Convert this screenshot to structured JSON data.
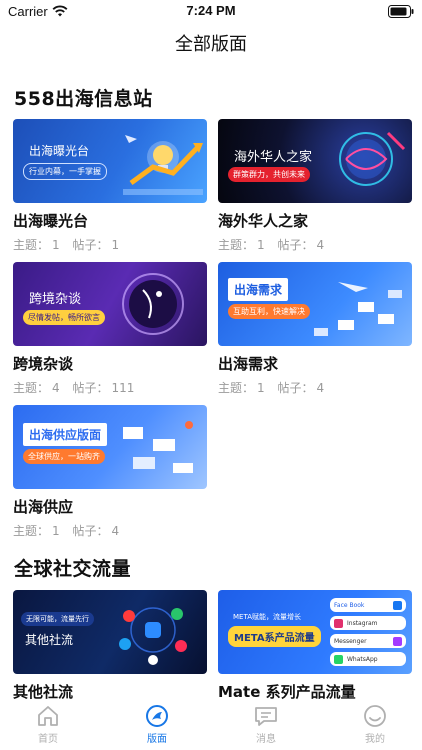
{
  "status": {
    "carrier": "Carrier",
    "time": "7:24 PM"
  },
  "nav": {
    "title": "全部版面"
  },
  "sections": [
    {
      "title": "558出海信息站",
      "cards": [
        {
          "name": "出海曝光台",
          "banner_text": "出海曝光台",
          "banner_sub": "行业内幕，一手掌握",
          "topics_label": "主题：",
          "topics": "1",
          "posts_label": "帖子：",
          "posts": "1"
        },
        {
          "name": "海外华人之家",
          "banner_text": "海外华人之家",
          "banner_sub": "群策群力，共创未来",
          "topics_label": "主题：",
          "topics": "1",
          "posts_label": "帖子：",
          "posts": "4"
        },
        {
          "name": "跨境杂谈",
          "banner_text": "跨境杂谈",
          "banner_sub": "尽情发帖，畅所欲言",
          "topics_label": "主题：",
          "topics": "4",
          "posts_label": "帖子：",
          "posts": "111"
        },
        {
          "name": "出海需求",
          "banner_text": "出海需求",
          "banner_sub": "互助互利，快速解决",
          "topics_label": "主题：",
          "topics": "1",
          "posts_label": "帖子：",
          "posts": "4"
        },
        {
          "name": "出海供应",
          "banner_text": "出海供应版面",
          "banner_sub": "全球供应，一站购齐",
          "topics_label": "主题：",
          "topics": "1",
          "posts_label": "帖子：",
          "posts": "4"
        }
      ]
    },
    {
      "title": "全球社交流量",
      "cards": [
        {
          "name": "其他社流",
          "banner_text": "其他社流",
          "banner_sub": "无限可能，流量先行"
        },
        {
          "name": "Mate 系列产品流量",
          "banner_text": "META系产品流量",
          "banner_sub": "META赋能，流量增长",
          "apps": [
            "Face Book",
            "Instagram",
            "Messenger",
            "WhatsApp"
          ]
        }
      ]
    }
  ],
  "tabs": [
    {
      "label": "首页",
      "icon": "home-icon",
      "active": false
    },
    {
      "label": "版面",
      "icon": "board-icon",
      "active": true
    },
    {
      "label": "消息",
      "icon": "message-icon",
      "active": false
    },
    {
      "label": "我的",
      "icon": "profile-icon",
      "active": false
    }
  ],
  "colors": {
    "accent": "#1877e6",
    "muted": "#9a9a9a",
    "inactive_tab": "#b0b0b0"
  }
}
